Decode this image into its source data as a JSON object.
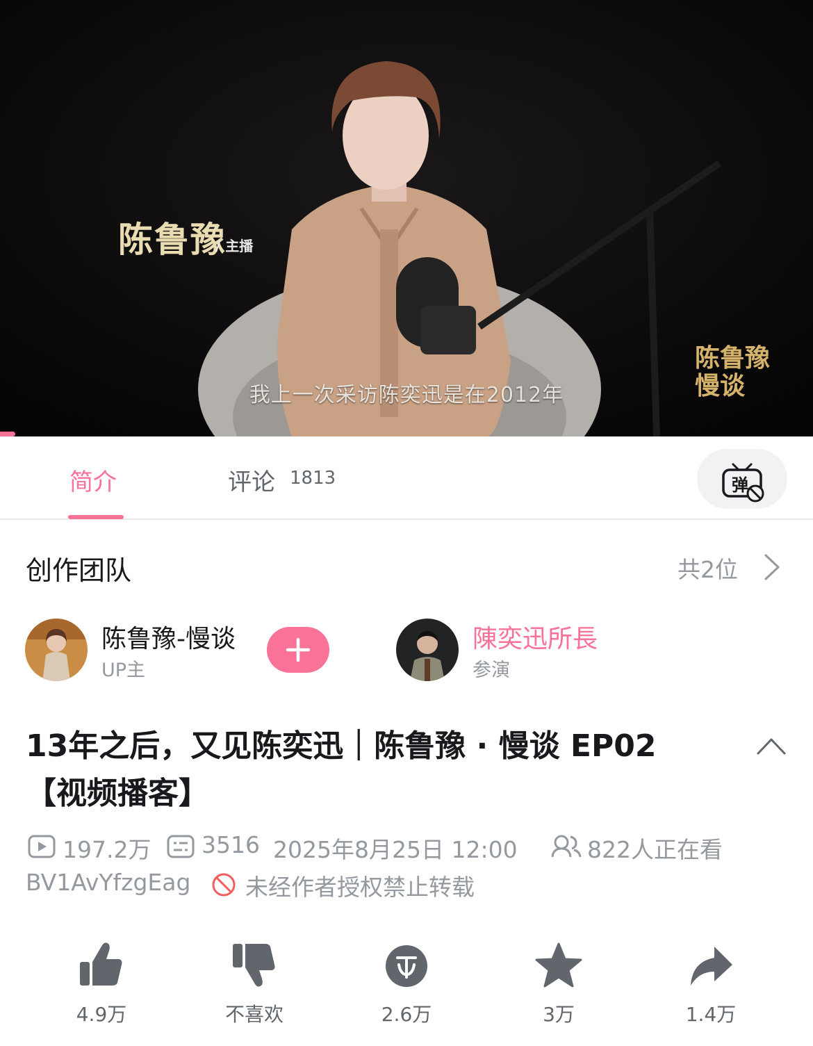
{
  "video": {
    "host_name": "陈鲁豫",
    "host_role": "/ 主播",
    "subtitle": "我上一次采访陈奕迅是在2012年",
    "show_logo_line1": "陈鲁豫",
    "show_logo_line2": "慢谈"
  },
  "tabs": {
    "intro_label": "简介",
    "comments_label": "评论",
    "comments_count": "1813",
    "danmaku_icon": "danmaku-off-icon"
  },
  "team": {
    "title": "创作团队",
    "count_label": "共2位",
    "members": [
      {
        "name": "陈鲁豫-慢谈",
        "role": "UP主",
        "name_color": "#18191c"
      },
      {
        "name": "陳奕迅所長",
        "role": "参演",
        "name_color": "#fb7299"
      }
    ]
  },
  "title": {
    "line1": "13年之后，又见陈奕迅｜陈鲁豫 · 慢谈 EP02",
    "line2": "【视频播客】"
  },
  "meta": {
    "views": "197.2万",
    "danmaku_count": "3516",
    "publish_time": "2025年8月25日 12:00",
    "watching": "822人正在看",
    "bvid": "BV1AvYfzgEag",
    "copyright_notice": "未经作者授权禁止转载"
  },
  "actions": [
    {
      "name": "like",
      "icon": "thumbs-up-icon",
      "count": "4.9万"
    },
    {
      "name": "dislike",
      "icon": "thumbs-down-icon",
      "count": "不喜欢"
    },
    {
      "name": "coin",
      "icon": "coin-icon",
      "count": "2.6万"
    },
    {
      "name": "favorite",
      "icon": "star-icon",
      "count": "3万"
    },
    {
      "name": "share",
      "icon": "share-icon",
      "count": "1.4万"
    }
  ],
  "colors": {
    "accent": "#fb7299",
    "text_primary": "#18191c",
    "text_secondary": "#9499a0",
    "icon_gray": "#61666d"
  }
}
